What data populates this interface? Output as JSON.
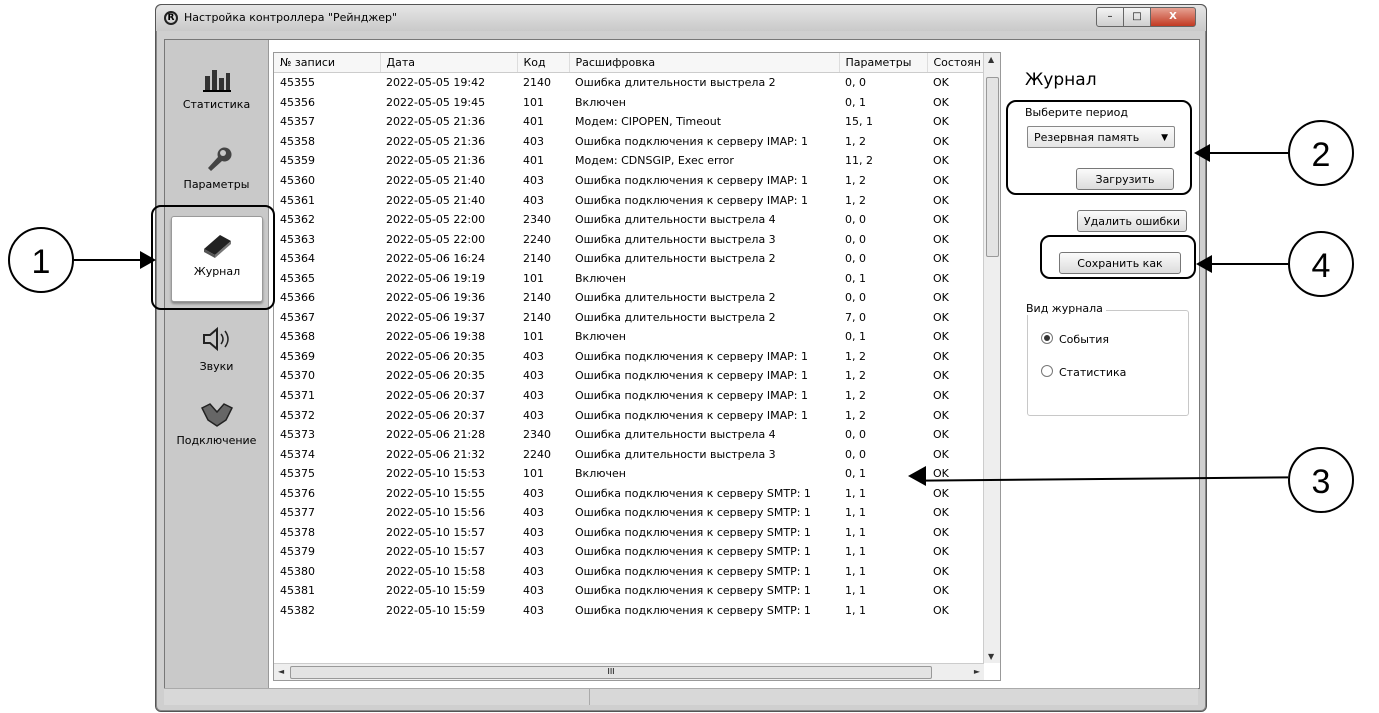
{
  "window": {
    "title": "Настройка контроллера \"Рейнджер\"",
    "controls": {
      "minimize": "–",
      "maximize": "□",
      "close": "X"
    }
  },
  "sidebar": {
    "items": [
      {
        "label": "Статистика",
        "icon": "chart-icon",
        "glyph": "▥"
      },
      {
        "label": "Параметры",
        "icon": "wrench-icon",
        "glyph": "🔧"
      },
      {
        "label": "Журнал",
        "icon": "journal-icon",
        "glyph": "▰"
      },
      {
        "label": "Звуки",
        "icon": "speaker-icon",
        "glyph": "🕪"
      },
      {
        "label": "Подключение",
        "icon": "handshake-icon",
        "glyph": "✋"
      }
    ],
    "active": "Журнал"
  },
  "table": {
    "columns": [
      "№ записи",
      "Дата",
      "Код",
      "Расшифровка",
      "Параметры",
      "Состоян"
    ],
    "rows": [
      [
        "45355",
        "2022-05-05 19:42",
        "2140",
        "Ошибка длительности выстрела 2",
        "0, 0",
        "OK"
      ],
      [
        "45356",
        "2022-05-05 19:45",
        "101",
        "Включен",
        "0, 1",
        "OK"
      ],
      [
        "45357",
        "2022-05-05 21:36",
        "401",
        "Модем: CIPOPEN, Timeout",
        "15, 1",
        "OK"
      ],
      [
        "45358",
        "2022-05-05 21:36",
        "403",
        "Ошибка подключения к серверу IMAP: 1",
        "1, 2",
        "OK"
      ],
      [
        "45359",
        "2022-05-05 21:36",
        "401",
        "Модем: CDNSGIP, Exec error",
        "11, 2",
        "OK"
      ],
      [
        "45360",
        "2022-05-05 21:40",
        "403",
        "Ошибка подключения к серверу IMAP: 1",
        "1, 2",
        "OK"
      ],
      [
        "45361",
        "2022-05-05 21:40",
        "403",
        "Ошибка подключения к серверу IMAP: 1",
        "1, 2",
        "OK"
      ],
      [
        "45362",
        "2022-05-05 22:00",
        "2340",
        "Ошибка длительности выстрела 4",
        "0, 0",
        "OK"
      ],
      [
        "45363",
        "2022-05-05 22:00",
        "2240",
        "Ошибка длительности выстрела 3",
        "0, 0",
        "OK"
      ],
      [
        "45364",
        "2022-05-06 16:24",
        "2140",
        "Ошибка длительности выстрела 2",
        "0, 0",
        "OK"
      ],
      [
        "45365",
        "2022-05-06 19:19",
        "101",
        "Включен",
        "0, 1",
        "OK"
      ],
      [
        "45366",
        "2022-05-06 19:36",
        "2140",
        "Ошибка длительности выстрела 2",
        "0, 0",
        "OK"
      ],
      [
        "45367",
        "2022-05-06 19:37",
        "2140",
        "Ошибка длительности выстрела 2",
        "7, 0",
        "OK"
      ],
      [
        "45368",
        "2022-05-06 19:38",
        "101",
        "Включен",
        "0, 1",
        "OK"
      ],
      [
        "45369",
        "2022-05-06 20:35",
        "403",
        "Ошибка подключения к серверу IMAP: 1",
        "1, 2",
        "OK"
      ],
      [
        "45370",
        "2022-05-06 20:35",
        "403",
        "Ошибка подключения к серверу IMAP: 1",
        "1, 2",
        "OK"
      ],
      [
        "45371",
        "2022-05-06 20:37",
        "403",
        "Ошибка подключения к серверу IMAP: 1",
        "1, 2",
        "OK"
      ],
      [
        "45372",
        "2022-05-06 20:37",
        "403",
        "Ошибка подключения к серверу IMAP: 1",
        "1, 2",
        "OK"
      ],
      [
        "45373",
        "2022-05-06 21:28",
        "2340",
        "Ошибка длительности выстрела 4",
        "0, 0",
        "OK"
      ],
      [
        "45374",
        "2022-05-06 21:32",
        "2240",
        "Ошибка длительности выстрела 3",
        "0, 0",
        "OK"
      ],
      [
        "45375",
        "2022-05-10 15:53",
        "101",
        "Включен",
        "0, 1",
        "OK"
      ],
      [
        "45376",
        "2022-05-10 15:55",
        "403",
        "Ошибка подключения к серверу SMTP: 1",
        "1, 1",
        "OK"
      ],
      [
        "45377",
        "2022-05-10 15:56",
        "403",
        "Ошибка подключения к серверу SMTP: 1",
        "1, 1",
        "OK"
      ],
      [
        "45378",
        "2022-05-10 15:57",
        "403",
        "Ошибка подключения к серверу SMTP: 1",
        "1, 1",
        "OK"
      ],
      [
        "45379",
        "2022-05-10 15:57",
        "403",
        "Ошибка подключения к серверу SMTP: 1",
        "1, 1",
        "OK"
      ],
      [
        "45380",
        "2022-05-10 15:58",
        "403",
        "Ошибка подключения к серверу SMTP: 1",
        "1, 1",
        "OK"
      ],
      [
        "45381",
        "2022-05-10 15:59",
        "403",
        "Ошибка подключения к серверу SMTP: 1",
        "1, 1",
        "OK"
      ],
      [
        "45382",
        "2022-05-10 15:59",
        "403",
        "Ошибка подключения к серверу SMTP: 1",
        "1, 1",
        "OK"
      ]
    ],
    "hscroll_grip": "III"
  },
  "panel": {
    "title": "Журнал",
    "period_label": "Выберите период",
    "period_value": "Резервная память",
    "load_button": "Загрузить",
    "delete_errors_button": "Удалить ошибки",
    "save_as_button": "Сохранить как",
    "view_group_label": "Вид журнала",
    "view_options": [
      "События",
      "Статистика"
    ],
    "view_selected": "События"
  },
  "callouts": [
    "1",
    "2",
    "3",
    "4"
  ]
}
